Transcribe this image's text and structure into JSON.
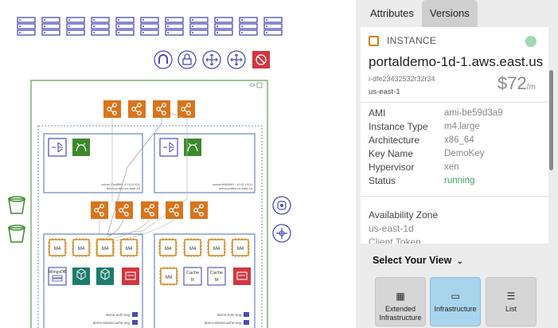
{
  "tabs": [
    {
      "label": "Attributes"
    },
    {
      "label": "Versions"
    }
  ],
  "instance": {
    "type_label": "INSTANCE",
    "hostname": "portaldemo-1d-1.aws.east.us",
    "instance_id": "i-dfe23432532r32r34",
    "region": "us-east-1",
    "price": "$72",
    "price_unit": "/m"
  },
  "attributes": [
    {
      "key": "AMI",
      "value": "ami-be59d3a9"
    },
    {
      "key": "Instance Type",
      "value": "m4.large"
    },
    {
      "key": "Architecture",
      "value": "x86_64"
    },
    {
      "key": "Key Name",
      "value": "DemoKey"
    },
    {
      "key": "Hypervisor",
      "value": "xen"
    },
    {
      "key": "Status",
      "value": "running"
    }
  ],
  "availability": {
    "key": "Availability Zone",
    "value": "us-east-1d",
    "next_key": "Client Token"
  },
  "select_view": {
    "label": "Select Your View",
    "options": [
      {
        "label_line1": "Extended",
        "label_line2": "Infrastructure",
        "icon": "grid-icon",
        "active": false
      },
      {
        "label_line1": "Infrastructure",
        "label_line2": "",
        "icon": "laptop-icon",
        "active": true
      },
      {
        "label_line1": "List",
        "label_line2": "",
        "icon": "list-icon",
        "active": false
      }
    ]
  },
  "diagram": {
    "subnet_a_label": "demo-public-us-east-1d",
    "subnet_b_label": "demo-public-us-east-1a",
    "subnet_a_id": "subnet-23cd5f89 - 10.20.0.0/24",
    "subnet_b_id": "subnet-b5a35b51 - 10.20.1.0/24",
    "instance_chip_label": "M4",
    "mongo_label": "MongoDB",
    "cache_r": "Cache R",
    "cache_m": "Cache M",
    "sg_a1": "demo-mdc-sng",
    "sg_a2": "demo-elasticcache-sng",
    "sg_b1": "demo-mdc-sng",
    "sg_b2": "demo-elasticcache-sng",
    "colors": {
      "orange": "#d9741c",
      "green": "#3b8a2c",
      "purple": "#4b4bb5",
      "red": "#d3363e",
      "teal": "#1e7c6d"
    }
  }
}
